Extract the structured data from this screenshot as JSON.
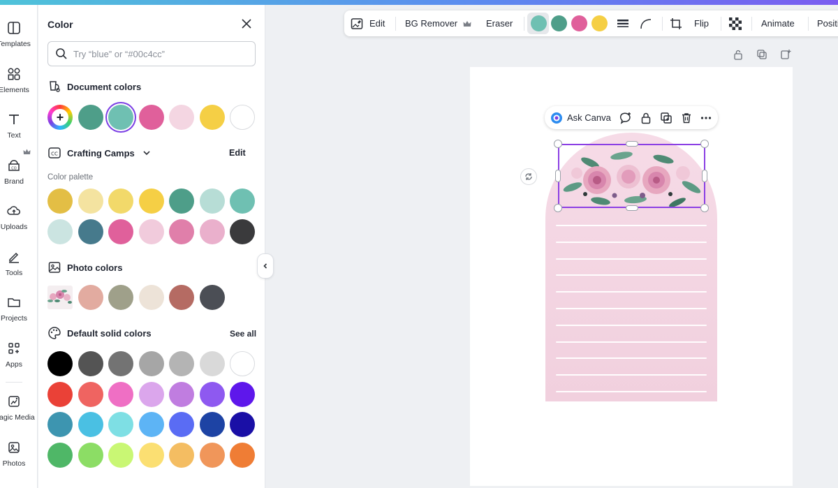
{
  "rail": {
    "items": [
      {
        "label": "Templates"
      },
      {
        "label": "Elements"
      },
      {
        "label": "Text"
      },
      {
        "label": "Brand"
      },
      {
        "label": "Uploads"
      },
      {
        "label": "Tools"
      },
      {
        "label": "Projects"
      },
      {
        "label": "Apps"
      },
      {
        "label": "Magic Media"
      },
      {
        "label": "Photos"
      }
    ]
  },
  "panel": {
    "title": "Color",
    "search_placeholder": "Try “blue” or “#00c4cc”",
    "document_colors": {
      "title": "Document colors",
      "swatches": [
        "#4e9e89",
        "#6fc0b2",
        "#e0609b",
        "#f4d6e2",
        "#f5cf45",
        "#ffffff"
      ]
    },
    "brand": {
      "title": "Crafting Camps",
      "edit": "Edit",
      "sublabel": "Color palette",
      "swatches": [
        "#e3be45",
        "#f4e3a0",
        "#f2d96a",
        "#f5cf45",
        "#4e9e89",
        "#b7ddd6",
        "#6fc0b2",
        "#cbe4e1",
        "#467a8c",
        "#e0609b",
        "#f1cbdc",
        "#e07faa",
        "#eab0cc",
        "#3a3a3c"
      ]
    },
    "photo_colors": {
      "title": "Photo colors",
      "swatches": [
        "#e2aba0",
        "#9fa08a",
        "#ede3d8",
        "#b56b63",
        "#4b4e55"
      ]
    },
    "default_colors": {
      "title": "Default solid colors",
      "see_all": "See all",
      "swatches": [
        "#000000",
        "#545454",
        "#737373",
        "#a6a6a6",
        "#b4b4b4",
        "#d9d9d9",
        "#ffffff",
        "#ea4137",
        "#ef6461",
        "#ef6fc4",
        "#dba6ec",
        "#c07de0",
        "#8e59f0",
        "#5e17eb",
        "#3d95b0",
        "#4ac0e3",
        "#7edfe4",
        "#5db4f5",
        "#5a6cf4",
        "#1d43a4",
        "#1a0fa6",
        "#4fb767",
        "#8cdd65",
        "#c9f774",
        "#fbdf72",
        "#f4bd62",
        "#f0965a",
        "#ef7d35"
      ]
    }
  },
  "toolbar": {
    "edit": "Edit",
    "bg_remover": "BG Remover",
    "eraser": "Eraser",
    "swatches": [
      "#6fc0b2",
      "#4e9e89",
      "#e0609b",
      "#f5cf45"
    ],
    "flip": "Flip",
    "animate": "Animate",
    "position": "Position"
  },
  "ask": {
    "label": "Ask Canva"
  }
}
